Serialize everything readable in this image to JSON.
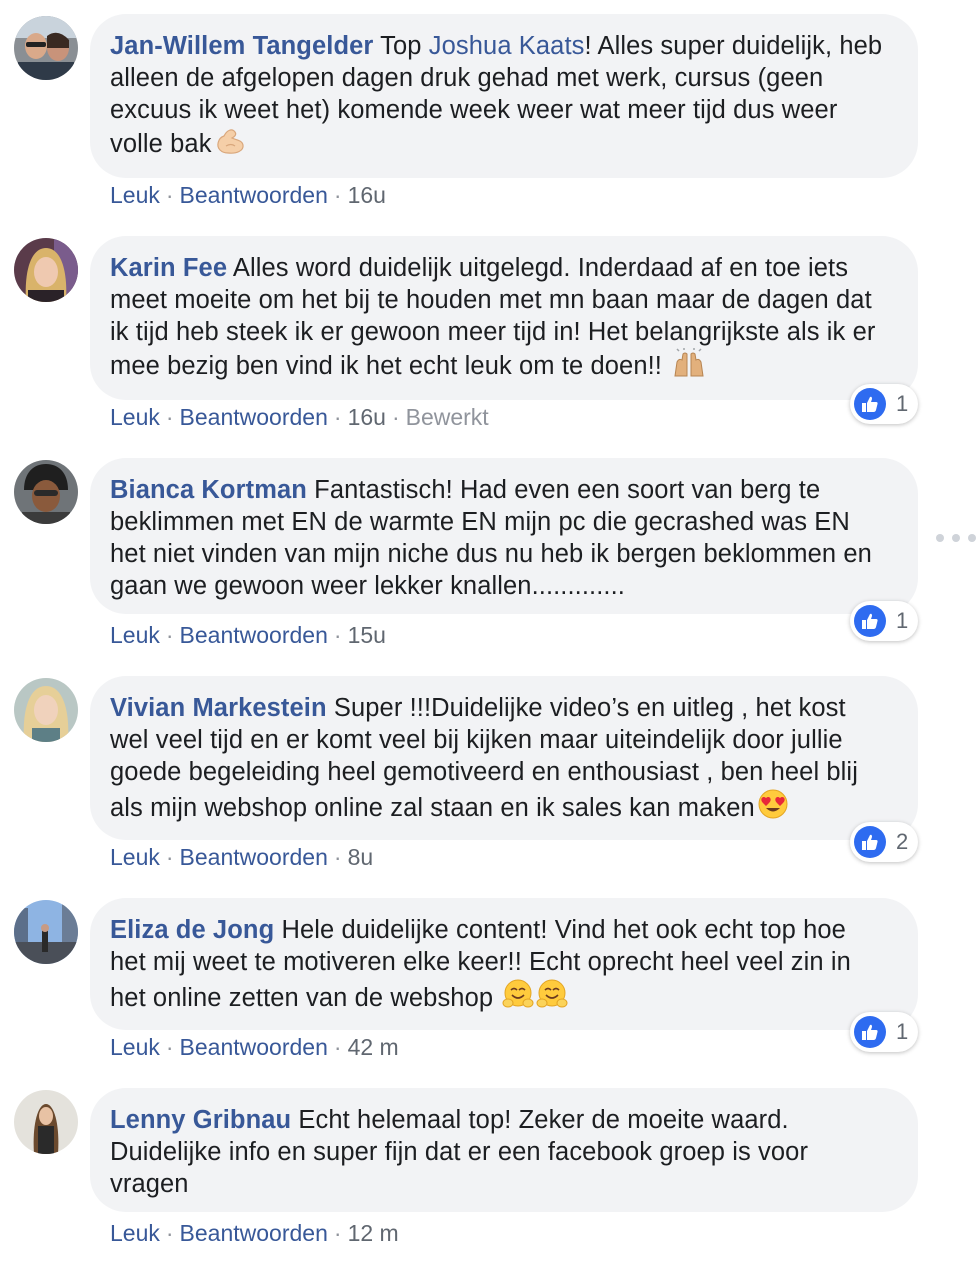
{
  "labels": {
    "like": "Leuk",
    "reply": "Beantwoorden",
    "separator": "·"
  },
  "comments": [
    {
      "author": "Jan-Willem Tangelder",
      "text_before": "Top",
      "mention": "Joshua Kaats",
      "text": "! Alles super duidelijk, heb alleen de afgelopen dagen druk gehad met werk, cursus (geen excuus ik weet het) komende week weer wat meer tijd dus weer volle bak",
      "emoji": "flexed-biceps-icon",
      "time": "16u",
      "edited": "",
      "reaction_count": ""
    },
    {
      "author": "Karin Fee",
      "text": "Alles word duidelijk uitgelegd. Inderdaad af en toe iets meet moeite om het bij te houden met mn baan maar de dagen dat ik tijd heb steek ik er gewoon meer tijd in! Het belangrijkste als ik er mee bezig ben vind ik het echt leuk om te doen!!",
      "emoji": "raising-hands-icon",
      "time": "16u",
      "edited": "Bewerkt",
      "reaction_count": "1"
    },
    {
      "author": "Bianca Kortman",
      "text": "Fantastisch! Had even een soort van berg te beklimmen met EN de warmte EN mijn pc die gecrashed was EN het niet vinden van mijn niche dus nu heb ik bergen beklommen en gaan we gewoon weer lekker knallen.............",
      "time": "15u",
      "reaction_count": "1"
    },
    {
      "author": "Vivian Markestein",
      "text": "Super !!!Duidelijke video’s en uitleg , het kost wel veel tijd en er komt veel bij kijken maar uiteindelijk door jullie goede begeleiding heel gemotiveerd en enthousiast , ben heel blij als mijn webshop online zal staan en ik sales kan maken",
      "emoji": "heart-eyes-icon",
      "time": "8u",
      "reaction_count": "2"
    },
    {
      "author": "Eliza de Jong",
      "text": "Hele duidelijke content! Vind het ook echt top hoe het mij weet te motiveren elke keer!! Echt oprecht heel veel zin in het online zetten van de webshop",
      "emoji": "hugging-face-icon",
      "time": "42 m",
      "reaction_count": "1"
    },
    {
      "author": "Lenny Gribnau",
      "text": "Echt helemaal top! Zeker de moeite waard. Duidelijke info en super fijn dat er een facebook groep is voor vragen",
      "time": "12 m",
      "reaction_count": ""
    }
  ],
  "colors": {
    "author": "#385898",
    "bubble": "#f2f3f5",
    "like_blue": "#2e6bf0",
    "meta_gray": "#606770"
  }
}
